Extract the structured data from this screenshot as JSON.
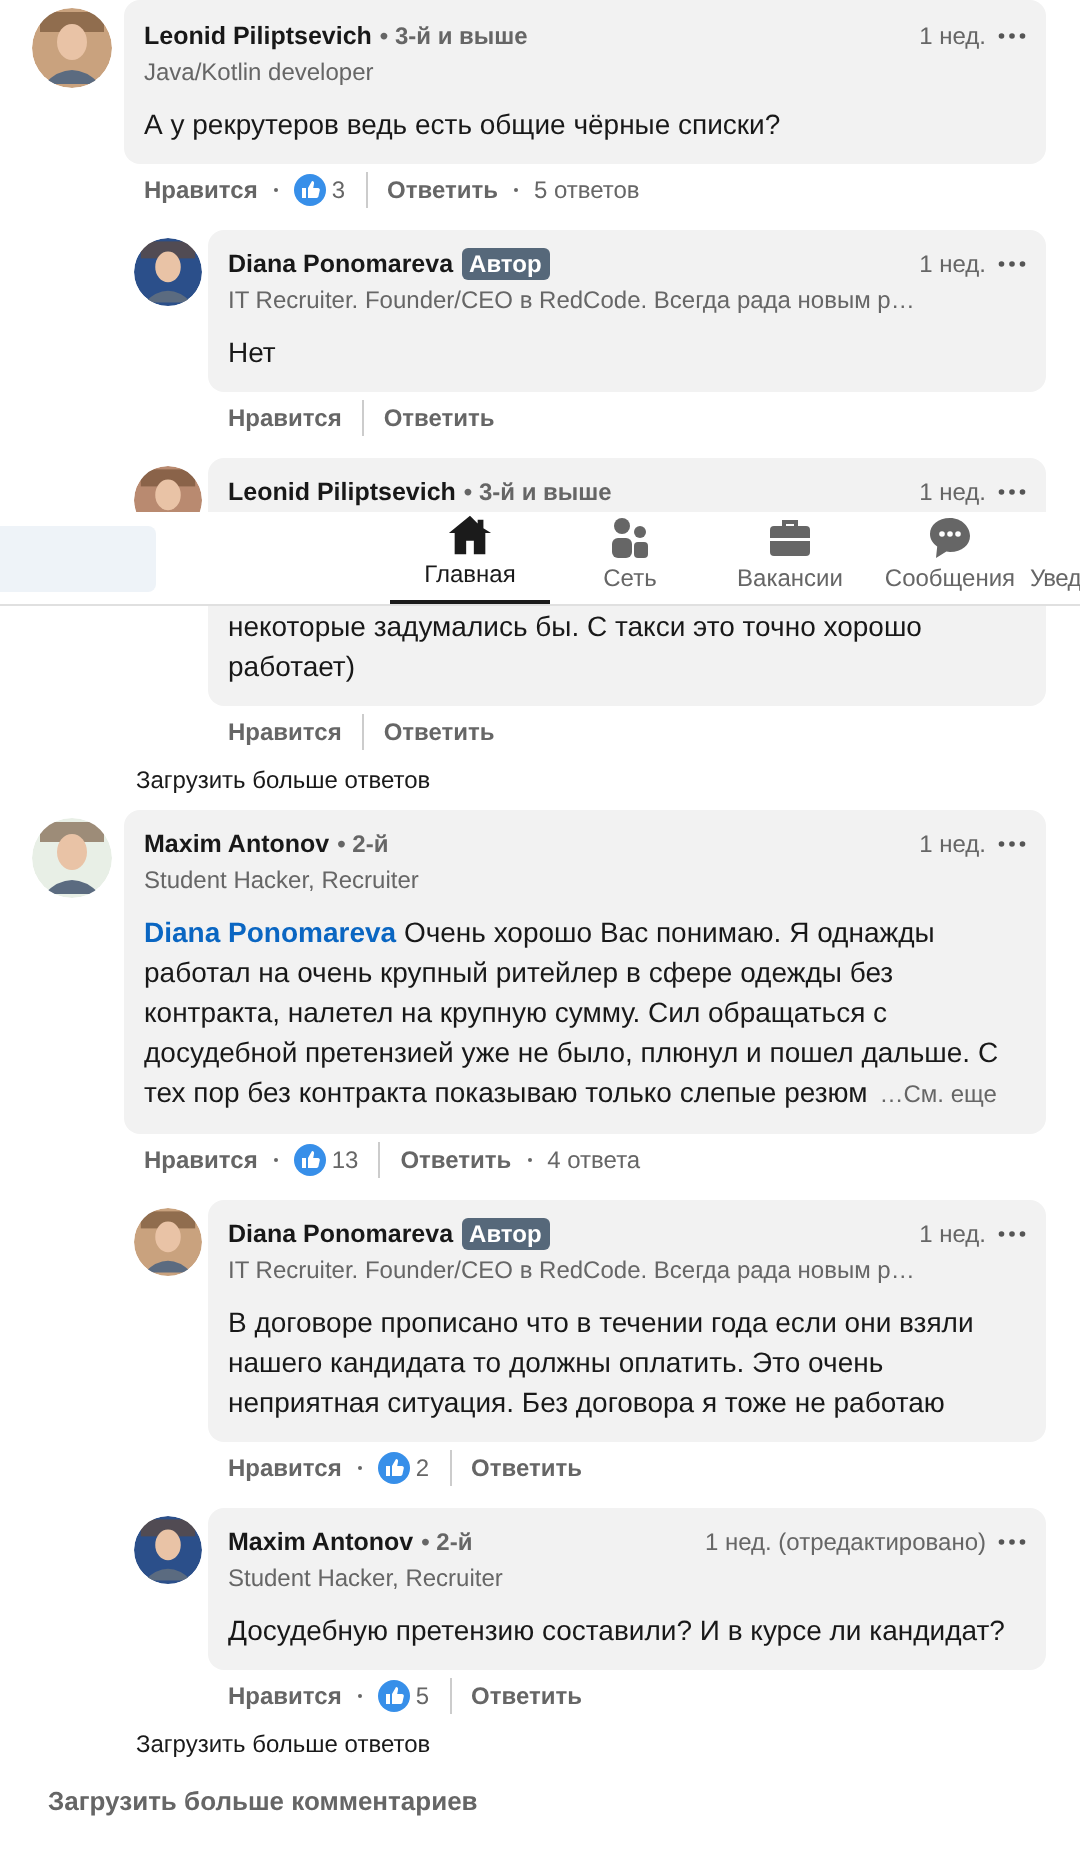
{
  "comments": [
    {
      "author": "Leonid Piliptsevich",
      "degree": "• 3-й и выше",
      "headline": "Java/Kotlin developer",
      "time": "1 нед.",
      "body": "А у рекрутеров ведь есть общие чёрные списки?",
      "like_label": "Нравится",
      "likes": "3",
      "reply_label": "Ответить",
      "replies_count": "5 ответов",
      "replies": [
        {
          "author": "Diana Ponomareva",
          "badge": "Автор",
          "headline": "IT Recruiter. Founder/CEO в RedCode. Всегда рада новым р…",
          "time": "1 нед.",
          "body": "Нет",
          "like_label": "Нравится",
          "reply_label": "Ответить"
        },
        {
          "author": "Leonid Piliptsevich",
          "degree": "• 3-й и выше",
          "time": "1 нед.",
          "body": "некоторые задумались бы. С такси это точно хорошо работает)",
          "like_label": "Нравится",
          "reply_label": "Ответить"
        }
      ],
      "load_more": "Загрузить больше ответов"
    },
    {
      "author": "Maxim Antonov",
      "degree": "• 2-й",
      "headline": "Student Hacker, Recruiter",
      "time": "1 нед.",
      "mention": "Diana Ponomareva",
      "body": "Очень хорошо Вас понимаю. Я однажды работал на очень крупный ритейлер в сфере одежды без контракта, налетел на крупную сумму. Сил обращаться с досудебной претензией уже не было, плюнул и пошел дальше. С тех пор без контракта показываю только слепые резюм",
      "see_more": "…См. еще",
      "like_label": "Нравится",
      "likes": "13",
      "reply_label": "Ответить",
      "replies_count": "4 ответа",
      "replies": [
        {
          "author": "Diana Ponomareva",
          "badge": "Автор",
          "headline": "IT Recruiter. Founder/CEO в RedCode. Всегда рада новым р…",
          "time": "1 нед.",
          "body": "В договоре прописано что в течении года если они взяли нашего кандидата то должны оплатить. Это очень неприятная ситуация. Без договора я тоже не работаю",
          "like_label": "Нравится",
          "likes": "2",
          "reply_label": "Ответить"
        },
        {
          "author": "Maxim Antonov",
          "degree": "• 2-й",
          "headline": "Student Hacker, Recruiter",
          "time": "1 нед. (отредактировано)",
          "body": "Досудебную претензию составили? И в курсе ли кандидат?",
          "like_label": "Нравится",
          "likes": "5",
          "reply_label": "Ответить"
        }
      ],
      "load_more": "Загрузить больше ответов"
    }
  ],
  "load_more_comments": "Загрузить больше комментариев",
  "nav": {
    "items": [
      {
        "label": "Главная",
        "kind": "home",
        "selected": true
      },
      {
        "label": "Сеть",
        "kind": "network",
        "selected": false
      },
      {
        "label": "Вакансии",
        "kind": "jobs",
        "selected": false
      },
      {
        "label": "Сообщения",
        "kind": "messages",
        "selected": false
      },
      {
        "label": "Увед",
        "selected": false
      }
    ]
  }
}
